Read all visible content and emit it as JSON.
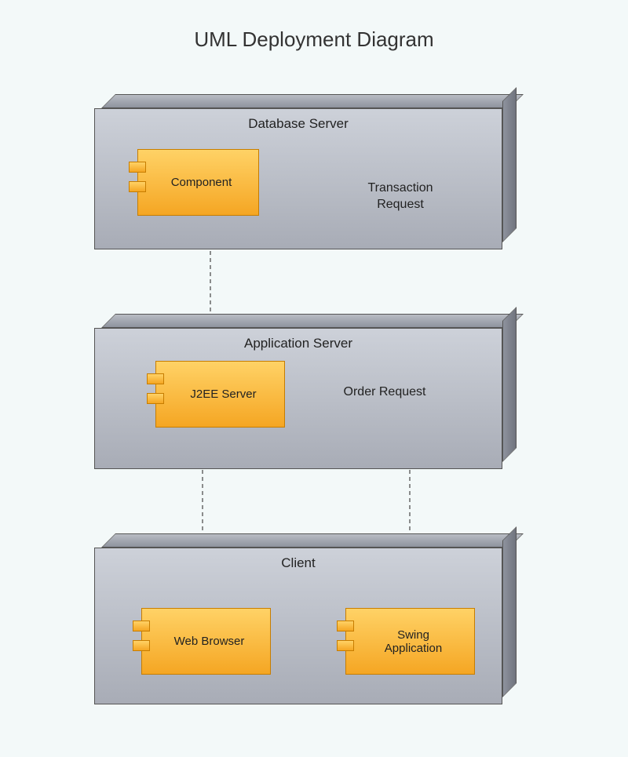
{
  "title": "UML Deployment Diagram",
  "nodes": {
    "database": {
      "label": "Database Server",
      "components": {
        "component": {
          "label": "Component"
        }
      },
      "interfaces": {
        "transaction": {
          "label": "Transaction\nRequest"
        }
      }
    },
    "application": {
      "label": "Application Server",
      "components": {
        "j2ee": {
          "label": "J2EE Server"
        }
      },
      "interfaces": {
        "order": {
          "label": "Order Request"
        }
      }
    },
    "client": {
      "label": "Client",
      "components": {
        "browser": {
          "label": "Web Browser"
        },
        "swing": {
          "label": "Swing\nApplication"
        }
      }
    }
  },
  "colors": {
    "nodeFill": "#b8bcc4",
    "componentFill": "#f5a623",
    "interfaceBall": "#2ecc71"
  }
}
